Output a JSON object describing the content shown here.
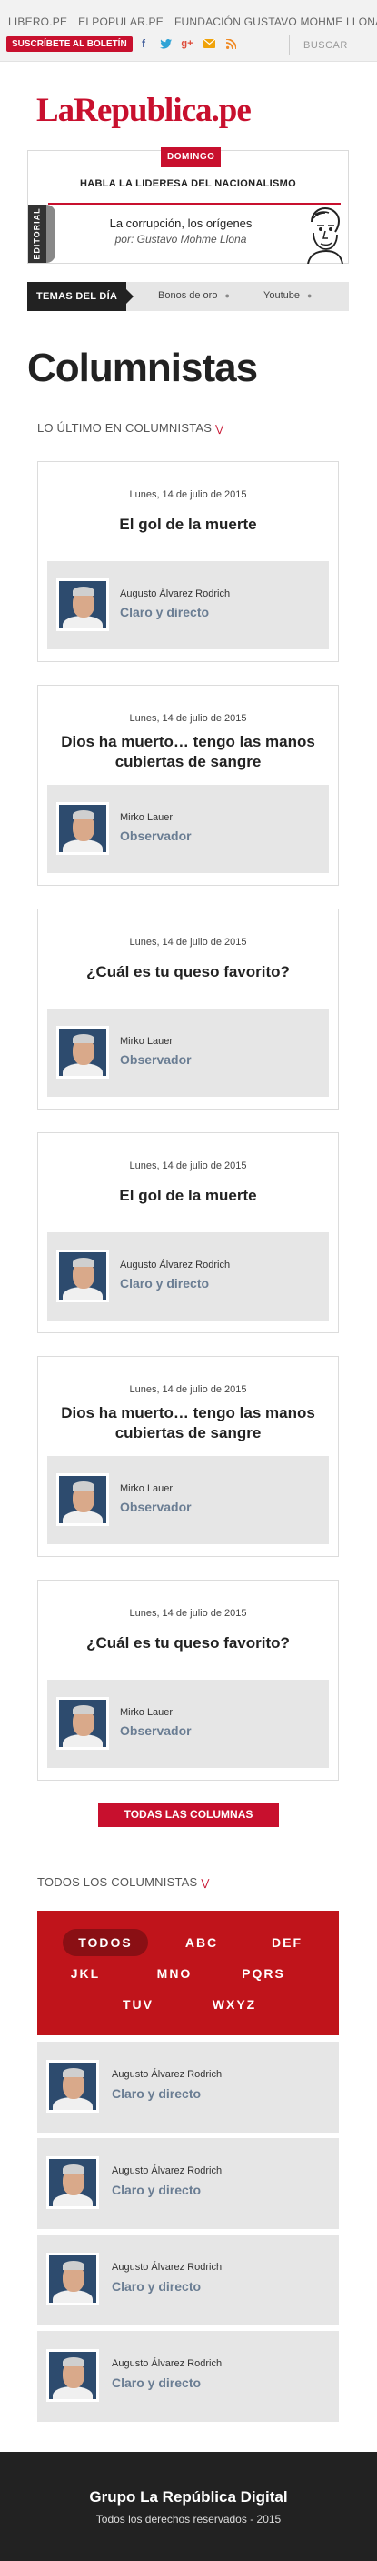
{
  "topbar": {
    "links": [
      "LIBERO.PE",
      "ELPOPULAR.PE",
      "FUNDACIÓN GUSTAVO MOHME LLONA"
    ],
    "subscribe_label": "SUSCRÍBETE AL BOLETÍN",
    "social_icons": [
      "facebook-icon",
      "twitter-icon",
      "google-plus-icon",
      "email-icon",
      "rss-icon"
    ],
    "search_label": "BUSCAR"
  },
  "brand": {
    "logo": "LaRepublica.pe",
    "color": "#c8102e"
  },
  "header": {
    "badge": "DOMINGO",
    "headline": "HABLA LA LIDERESA DEL NACIONALISMO",
    "editorial_label": "EDITORIAL",
    "editorial_title": "La corrupción, los orígenes",
    "editorial_author": "por: Gustavo Mohme Llona"
  },
  "temas": {
    "label": "TEMAS DEL DÍA",
    "items": [
      "Bonos de oro",
      "Youtube"
    ]
  },
  "page_title": "Columnistas",
  "latest_title": "LO ÚLTIMO EN COLUMNISTAS",
  "cards": [
    {
      "date": "Lunes, 14 de julio de 2015",
      "title": "El gol de la muerte",
      "author": "Augusto Álvarez Rodrich",
      "column": "Claro y directo"
    },
    {
      "date": "Lunes, 14 de julio de 2015",
      "title": "Dios ha muerto… tengo las manos cubiertas de sangre",
      "author": "Mirko Lauer",
      "column": "Observador"
    },
    {
      "date": "Lunes, 14 de julio de 2015",
      "title": "¿Cuál es tu queso favorito?",
      "author": "Mirko Lauer",
      "column": "Observador"
    },
    {
      "date": "Lunes, 14 de julio de 2015",
      "title": "El gol de la muerte",
      "author": "Augusto Álvarez Rodrich",
      "column": "Claro y directo"
    },
    {
      "date": "Lunes, 14 de julio de 2015",
      "title": "Dios ha muerto… tengo las manos cubiertas de sangre",
      "author": "Mirko Lauer",
      "column": "Observador"
    },
    {
      "date": "Lunes, 14 de julio de 2015",
      "title": "¿Cuál es tu queso favorito?",
      "author": "Mirko Lauer",
      "column": "Observador"
    }
  ],
  "all_columns_label": "TODAS LAS COLUMNAS",
  "all_columnists_title": "TODOS LOS COLUMNISTAS",
  "alpha_filters": [
    "TODOS",
    "ABC",
    "DEF",
    "JKL",
    "MNO",
    "PQRS",
    "TUV",
    "WXYZ"
  ],
  "alpha_active": "TODOS",
  "columnists": [
    {
      "name": "Augusto Álvarez Rodrich",
      "column": "Claro y directo"
    },
    {
      "name": "Augusto Álvarez Rodrich",
      "column": "Claro y directo"
    },
    {
      "name": "Augusto Álvarez Rodrich",
      "column": "Claro y directo"
    },
    {
      "name": "Augusto Álvarez Rodrich",
      "column": "Claro y directo"
    }
  ],
  "footer": {
    "title": "Grupo La República Digital",
    "copyright": "Todos los derechos reservados - 2015"
  }
}
